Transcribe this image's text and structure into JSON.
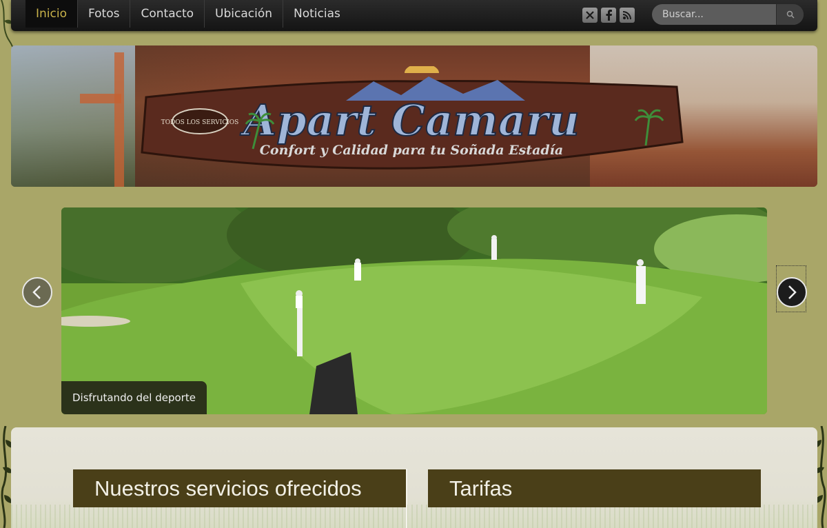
{
  "nav": {
    "items": [
      {
        "label": "Inicio",
        "active": true
      },
      {
        "label": "Fotos",
        "active": false
      },
      {
        "label": "Contacto",
        "active": false
      },
      {
        "label": "Ubicación",
        "active": false
      },
      {
        "label": "Noticias",
        "active": false
      }
    ],
    "social": [
      "x-icon",
      "facebook-icon",
      "rss-icon"
    ],
    "search_placeholder": "Buscar..."
  },
  "header": {
    "logo_title": "Apart Camaru",
    "logo_tagline": "Confort y Calidad para tu Soñada Estadía",
    "logo_badge": "TODOS LOS SERVICIOS"
  },
  "slider": {
    "caption": "Disfrutando del deporte",
    "prev_icon": "chevron-left-icon",
    "next_icon": "chevron-right-icon"
  },
  "sections": {
    "services_title": "Nuestros servicios ofrecidos",
    "rates_title": "Tarifas"
  },
  "colors": {
    "page_bg": "#a9a668",
    "nav_active_text": "#c8b24a",
    "section_head_bg": "#4a3f18"
  }
}
